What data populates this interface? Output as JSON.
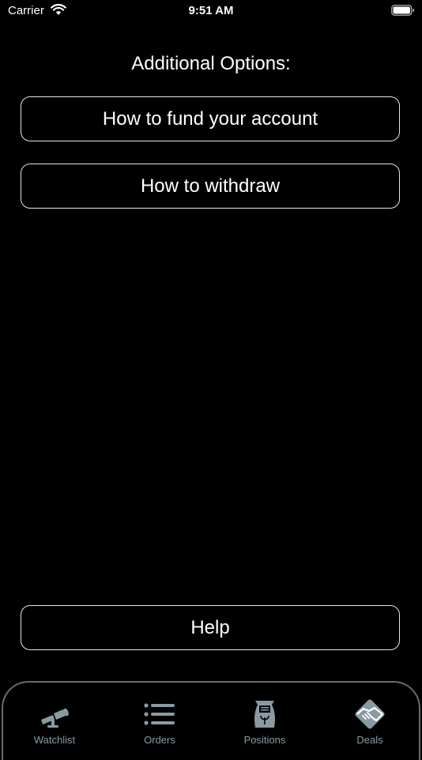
{
  "status_bar": {
    "carrier": "Carrier",
    "time": "9:51 AM"
  },
  "main": {
    "section_title": "Additional Options:",
    "options": [
      {
        "label": "How to fund your account"
      },
      {
        "label": "How to withdraw"
      }
    ],
    "help_label": "Help"
  },
  "tab_bar": {
    "tabs": [
      {
        "label": "Watchlist",
        "icon": "spyglass-icon"
      },
      {
        "label": "Orders",
        "icon": "list-icon"
      },
      {
        "label": "Positions",
        "icon": "seed-bag-icon"
      },
      {
        "label": "Deals",
        "icon": "handshake-icon"
      }
    ]
  },
  "colors": {
    "background": "#000000",
    "text": "#ffffff",
    "button_border": "#e6e6e6",
    "tab_icon": "#8a9aa3",
    "tab_bar_border": "#6b6b6b"
  }
}
